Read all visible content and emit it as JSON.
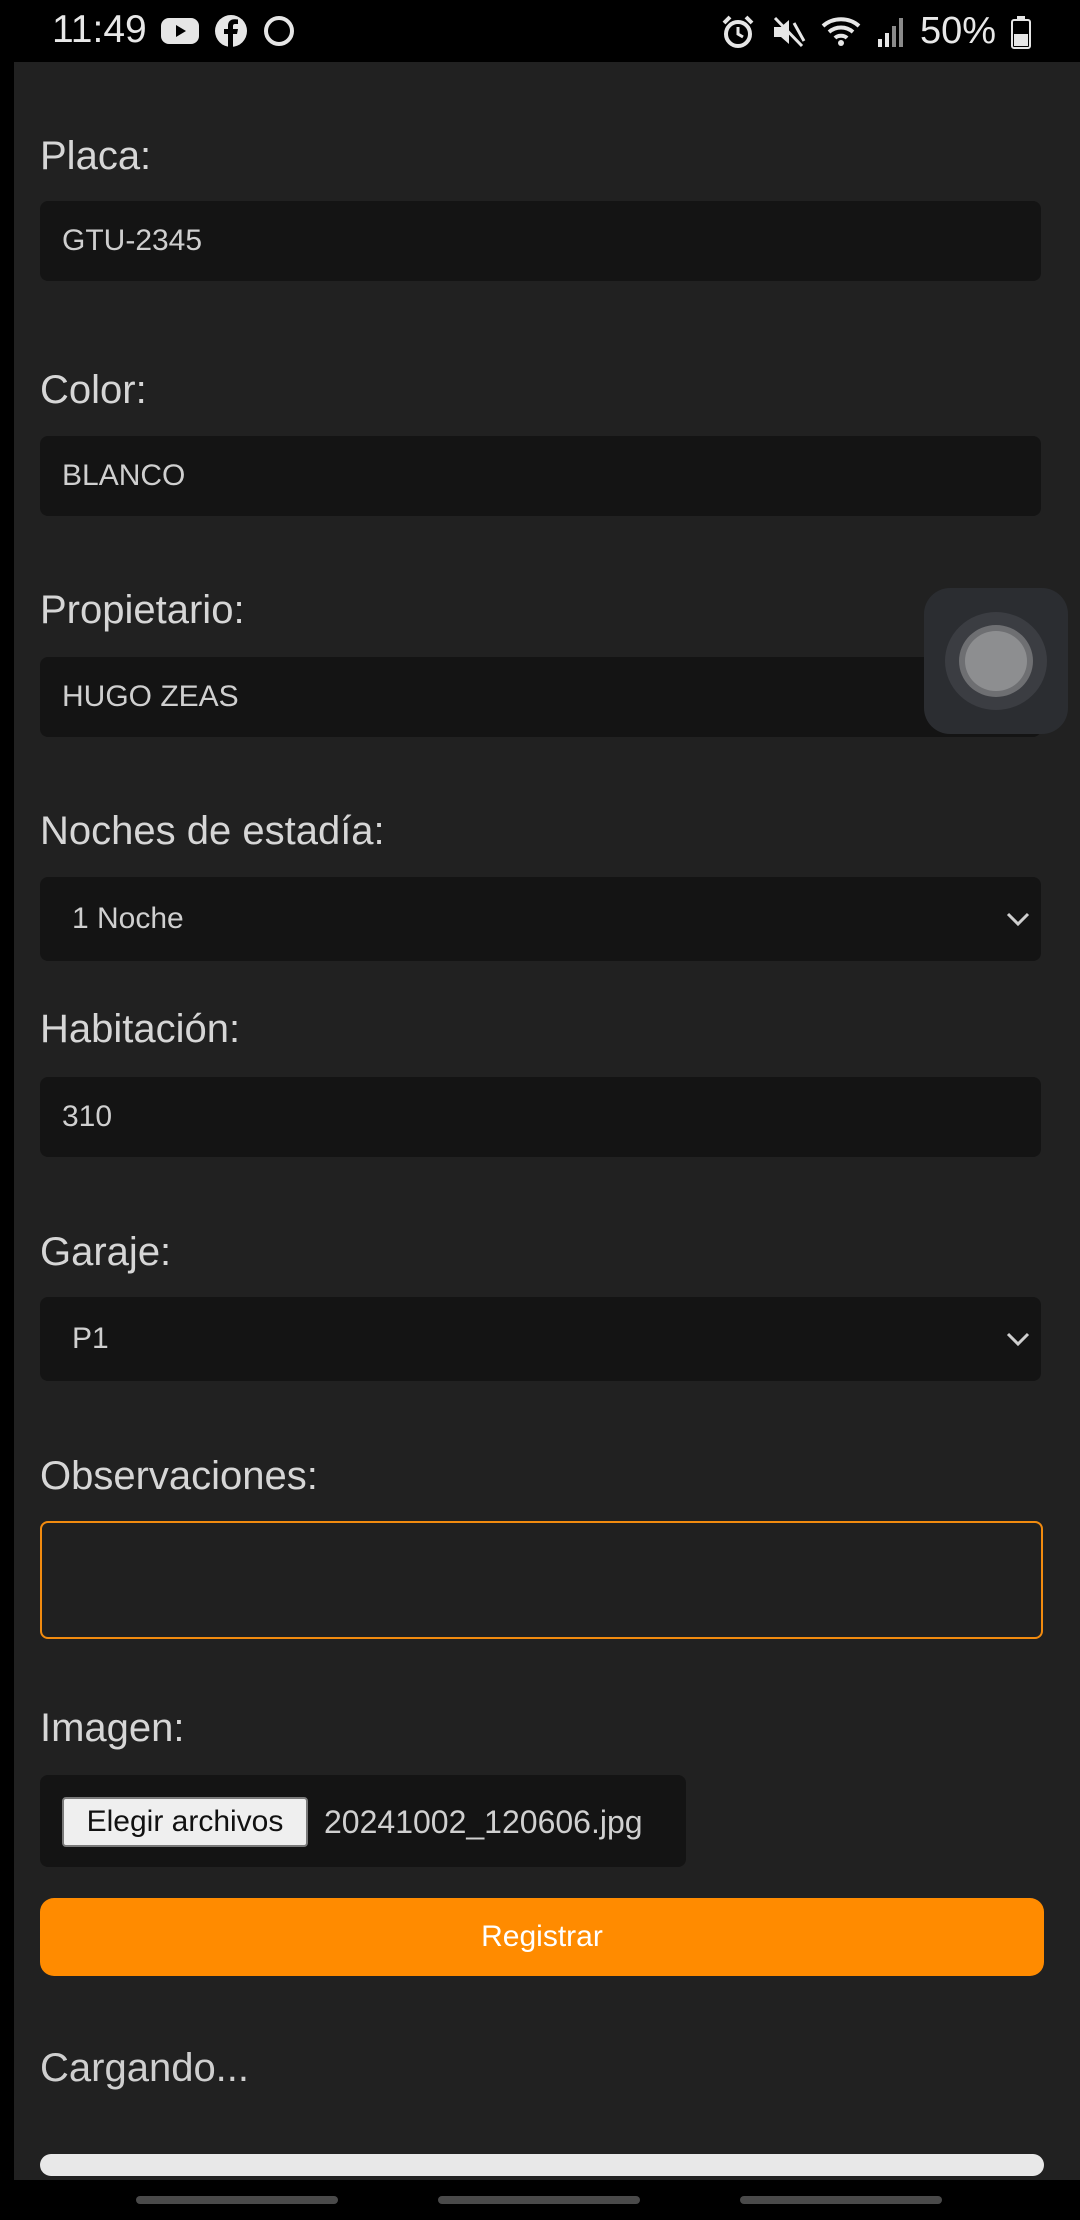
{
  "status_bar": {
    "time": "11:49",
    "left_icons": [
      "youtube-icon",
      "facebook-icon",
      "circle-icon"
    ],
    "right_icons": [
      "alarm-icon",
      "mute-icon",
      "wifi-icon",
      "signal-icon",
      "battery-icon"
    ],
    "battery": "50%"
  },
  "form": {
    "placa": {
      "label": "Placa:",
      "value": "GTU-2345"
    },
    "color": {
      "label": "Color:",
      "value": "BLANCO"
    },
    "propietario": {
      "label": "Propietario:",
      "value": "HUGO ZEAS"
    },
    "noches": {
      "label": "Noches de estadía:",
      "value": "1 Noche"
    },
    "habitacion": {
      "label": "Habitación:",
      "value": "310"
    },
    "garaje": {
      "label": "Garaje:",
      "value": "P1"
    },
    "observaciones": {
      "label": "Observaciones:",
      "value": ""
    },
    "imagen": {
      "label": "Imagen:",
      "button_label": "Elegir archivos",
      "file_name": "20241002_120606.jpg"
    },
    "submit_label": "Registrar",
    "loading_text": "Cargando..."
  },
  "colors": {
    "accent": "#ff8b00",
    "background": "#212121",
    "field_background": "#141414",
    "focus_border": "#f28b0f"
  }
}
